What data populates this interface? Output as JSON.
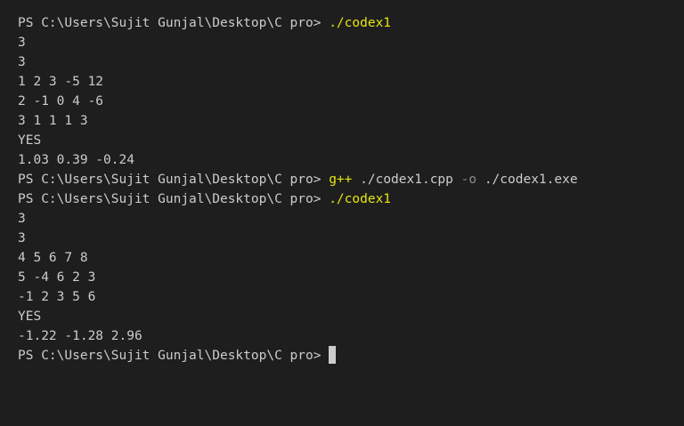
{
  "terminal": {
    "prompt": "PS C:\\Users\\Sujit Gunjal\\Desktop\\C pro> ",
    "run1": {
      "command": "./codex1",
      "output": [
        "3",
        "3",
        "1 2 3 -5 12",
        "2 -1 0 4 -6",
        "3 1 1 1 3",
        "YES",
        "1.03 0.39 -0.24"
      ]
    },
    "compile": {
      "program": "g++",
      "source": " ./codex1.cpp ",
      "flag": "-o",
      "target": " ./codex1.exe"
    },
    "run2": {
      "command": "./codex1",
      "output": [
        "3",
        "3",
        "4 5 6 7 8",
        "5 -4 6 2 3",
        "-1 2 3 5 6",
        "YES",
        "-1.22 -1.28 2.96"
      ]
    },
    "colors": {
      "background": "#1e1e1e",
      "text": "#cccccc",
      "command": "#e5e510",
      "flag": "#8a8a8a"
    }
  }
}
